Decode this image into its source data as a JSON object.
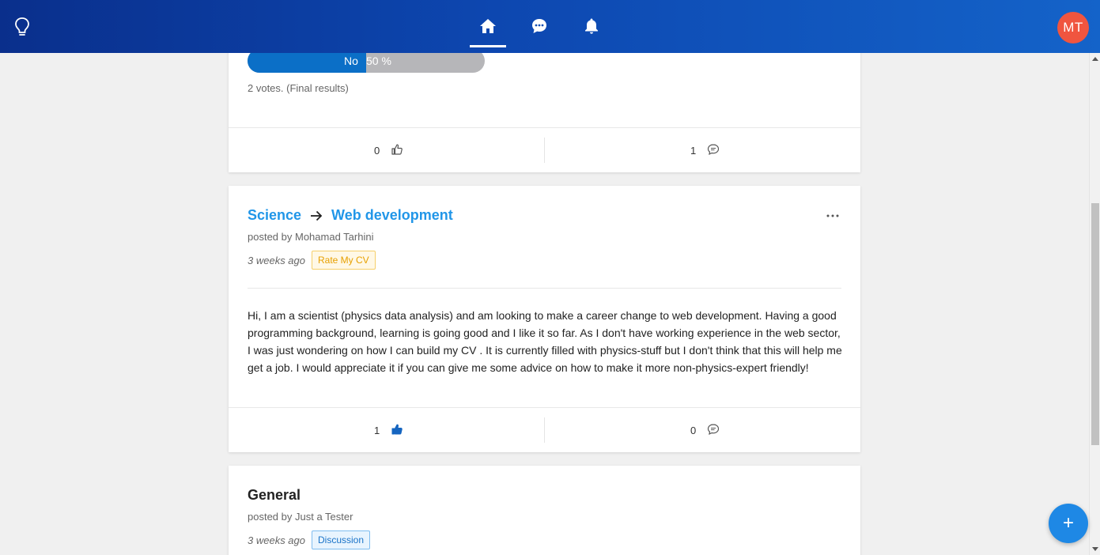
{
  "header": {
    "avatar_initials": "MT",
    "colors": {
      "bar_start": "#0a2f8c",
      "bar_end": "#1463c9",
      "avatar": "#f0553f"
    },
    "icons": [
      "lightbulb-icon",
      "home-icon",
      "chat-icon",
      "bell-icon"
    ]
  },
  "poll_card": {
    "option_label": "No",
    "percent_label": "50 %",
    "percent_value": 50,
    "votes_text": "2 votes. (Final results)",
    "likes": "0",
    "comments": "1"
  },
  "post": {
    "category": "Science",
    "subcategory": "Web development",
    "posted_by": "posted by Mohamad Tarhini",
    "time_ago": "3 weeks ago",
    "tag": "Rate My CV",
    "body": "Hi, I am a scientist (physics data analysis) and am looking to make a career change to web development. Having a good programming background, learning is going good and I like it so far. As I don't have working experience in the web sector, I was just wondering on how I can build my CV . It is currently filled with physics-stuff but I don't think that this will help me get a job. I would appreciate it if you can give me some advice on how to make it more non-physics-expert friendly!",
    "likes": "1",
    "liked": true,
    "comments": "0"
  },
  "post3": {
    "category": "General",
    "posted_by": "posted by Just a Tester",
    "time_ago": "3 weeks ago",
    "tag": "Discussion"
  },
  "fab": {
    "label": "+"
  }
}
